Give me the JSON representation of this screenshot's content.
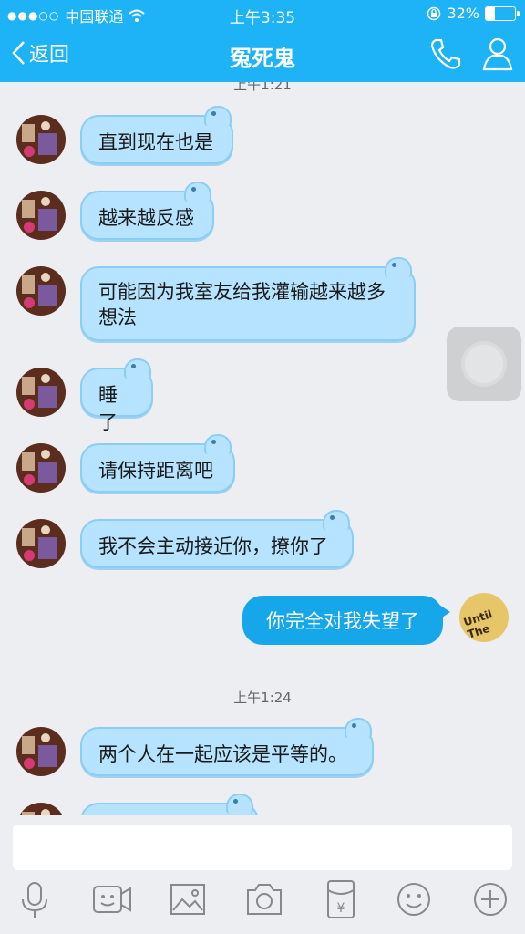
{
  "status": {
    "signal": "●●●○○",
    "carrier": "中国联通",
    "time": "上午3:35",
    "battery_text": "32%",
    "battery_level": 0.32
  },
  "nav": {
    "back_label": "返回",
    "title": "冤死鬼"
  },
  "timestamps": {
    "first": "上午1:21",
    "second": "上午1:24"
  },
  "messages_in": [
    "直到现在也是",
    "越来越反感",
    "可能因为我室友给我灌输越来越多",
    "想法",
    "睡了",
    "请保持距离吧",
    "我不会主动接近你，撩你了",
    "两个人在一起应该是平等的。"
  ],
  "message_out": "你完全对我失望了",
  "self_avatar_text": "Until The",
  "colors": {
    "header": "#1eb3f6",
    "bubble_in": "#b6e3ff",
    "bubble_out": "#16a6ea"
  },
  "icons": [
    "phone-icon",
    "profile-icon",
    "microphone-icon",
    "video-icon",
    "image-icon",
    "camera-icon",
    "red-packet-icon",
    "emoji-icon",
    "plus-icon"
  ]
}
